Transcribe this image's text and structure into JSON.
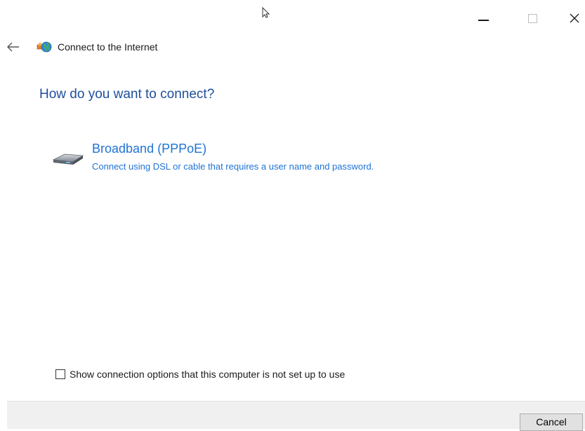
{
  "window": {
    "minimize_glyph": "—",
    "close_glyph": "✕"
  },
  "nav": {
    "back_icon": "back-arrow-icon",
    "app_icon": "network-globe-icon",
    "title": "Connect to the Internet"
  },
  "main": {
    "heading": "How do you want to connect?",
    "options": [
      {
        "icon": "broadband-modem-icon",
        "title": "Broadband (PPPoE)",
        "description": "Connect using DSL or cable that requires a user name and password."
      }
    ],
    "show_options_checkbox": {
      "label": "Show connection options that this computer is not set up to use",
      "checked": false
    }
  },
  "footer": {
    "cancel_label": "Cancel"
  },
  "colors": {
    "heading": "#1e4e9b",
    "link": "#1e73d6",
    "footer_bg": "#f0f0f0"
  }
}
